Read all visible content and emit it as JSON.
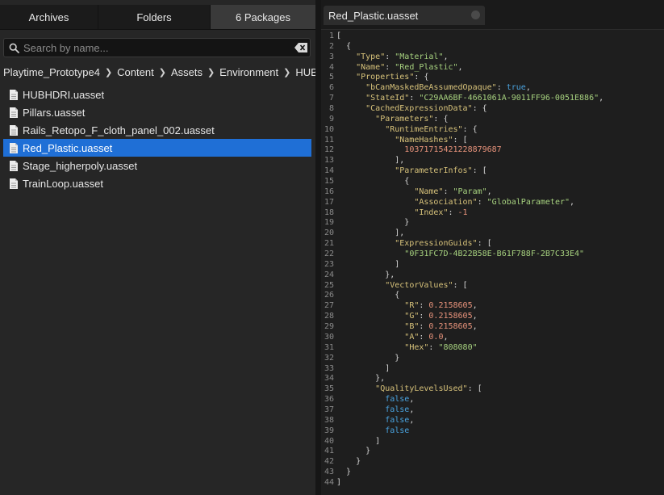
{
  "left_panel": {
    "tabs": [
      "Archives",
      "Folders",
      "6 Packages"
    ],
    "active_tab": "6 Packages",
    "search": {
      "placeholder": "Search by name..."
    },
    "breadcrumb": [
      "Playtime_Prototype4",
      "Content",
      "Assets",
      "Environment",
      "HUB"
    ],
    "files": [
      "HUBHDRI.uasset",
      "Pillars.uasset",
      "Rails_Retopo_F_cloth_panel_002.uasset",
      "Red_Plastic.uasset",
      "Stage_higherpoly.uasset",
      "TrainLoop.uasset"
    ],
    "selected_file": "Red_Plastic.uasset"
  },
  "editor": {
    "tab_title": "Red_Plastic.uasset",
    "lines": [
      [
        [
          "p",
          "["
        ]
      ],
      [
        [
          "p",
          "  {"
        ]
      ],
      [
        [
          "p",
          "    "
        ],
        [
          "k",
          "\"Type\""
        ],
        [
          "p",
          ": "
        ],
        [
          "s",
          "\"Material\""
        ],
        [
          "p",
          ","
        ]
      ],
      [
        [
          "p",
          "    "
        ],
        [
          "k",
          "\"Name\""
        ],
        [
          "p",
          ": "
        ],
        [
          "s",
          "\"Red_Plastic\""
        ],
        [
          "p",
          ","
        ]
      ],
      [
        [
          "p",
          "    "
        ],
        [
          "k",
          "\"Properties\""
        ],
        [
          "p",
          ": {"
        ]
      ],
      [
        [
          "p",
          "      "
        ],
        [
          "k",
          "\"bCanMaskedBeAssumedOpaque\""
        ],
        [
          "p",
          ": "
        ],
        [
          "b",
          "true"
        ],
        [
          "p",
          ","
        ]
      ],
      [
        [
          "p",
          "      "
        ],
        [
          "k",
          "\"StateId\""
        ],
        [
          "p",
          ": "
        ],
        [
          "s",
          "\"C29AA6BF-4661061A-9011FF96-0051E886\""
        ],
        [
          "p",
          ","
        ]
      ],
      [
        [
          "p",
          "      "
        ],
        [
          "k",
          "\"CachedExpressionData\""
        ],
        [
          "p",
          ": {"
        ]
      ],
      [
        [
          "p",
          "        "
        ],
        [
          "k",
          "\"Parameters\""
        ],
        [
          "p",
          ": {"
        ]
      ],
      [
        [
          "p",
          "          "
        ],
        [
          "k",
          "\"RuntimeEntries\""
        ],
        [
          "p",
          ": {"
        ]
      ],
      [
        [
          "p",
          "            "
        ],
        [
          "k",
          "\"NameHashes\""
        ],
        [
          "p",
          ": ["
        ]
      ],
      [
        [
          "p",
          "              "
        ],
        [
          "n",
          "10371715421228879687"
        ]
      ],
      [
        [
          "p",
          "            ],"
        ]
      ],
      [
        [
          "p",
          "            "
        ],
        [
          "k",
          "\"ParameterInfos\""
        ],
        [
          "p",
          ": ["
        ]
      ],
      [
        [
          "p",
          "              {"
        ]
      ],
      [
        [
          "p",
          "                "
        ],
        [
          "k",
          "\"Name\""
        ],
        [
          "p",
          ": "
        ],
        [
          "s",
          "\"Param\""
        ],
        [
          "p",
          ","
        ]
      ],
      [
        [
          "p",
          "                "
        ],
        [
          "k",
          "\"Association\""
        ],
        [
          "p",
          ": "
        ],
        [
          "s",
          "\"GlobalParameter\""
        ],
        [
          "p",
          ","
        ]
      ],
      [
        [
          "p",
          "                "
        ],
        [
          "k",
          "\"Index\""
        ],
        [
          "p",
          ": "
        ],
        [
          "n",
          "-1"
        ]
      ],
      [
        [
          "p",
          "              }"
        ]
      ],
      [
        [
          "p",
          "            ],"
        ]
      ],
      [
        [
          "p",
          "            "
        ],
        [
          "k",
          "\"ExpressionGuids\""
        ],
        [
          "p",
          ": ["
        ]
      ],
      [
        [
          "p",
          "              "
        ],
        [
          "s",
          "\"0F31FC7D-4B22B58E-B61F788F-2B7C33E4\""
        ]
      ],
      [
        [
          "p",
          "            ]"
        ]
      ],
      [
        [
          "p",
          "          },"
        ]
      ],
      [
        [
          "p",
          "          "
        ],
        [
          "k",
          "\"VectorValues\""
        ],
        [
          "p",
          ": ["
        ]
      ],
      [
        [
          "p",
          "            {"
        ]
      ],
      [
        [
          "p",
          "              "
        ],
        [
          "k",
          "\"R\""
        ],
        [
          "p",
          ": "
        ],
        [
          "n",
          "0.2158605"
        ],
        [
          "p",
          ","
        ]
      ],
      [
        [
          "p",
          "              "
        ],
        [
          "k",
          "\"G\""
        ],
        [
          "p",
          ": "
        ],
        [
          "n",
          "0.2158605"
        ],
        [
          "p",
          ","
        ]
      ],
      [
        [
          "p",
          "              "
        ],
        [
          "k",
          "\"B\""
        ],
        [
          "p",
          ": "
        ],
        [
          "n",
          "0.2158605"
        ],
        [
          "p",
          ","
        ]
      ],
      [
        [
          "p",
          "              "
        ],
        [
          "k",
          "\"A\""
        ],
        [
          "p",
          ": "
        ],
        [
          "n",
          "0.0"
        ],
        [
          "p",
          ","
        ]
      ],
      [
        [
          "p",
          "              "
        ],
        [
          "k",
          "\"Hex\""
        ],
        [
          "p",
          ": "
        ],
        [
          "s",
          "\"808080\""
        ]
      ],
      [
        [
          "p",
          "            }"
        ]
      ],
      [
        [
          "p",
          "          ]"
        ]
      ],
      [
        [
          "p",
          "        },"
        ]
      ],
      [
        [
          "p",
          "        "
        ],
        [
          "k",
          "\"QualityLevelsUsed\""
        ],
        [
          "p",
          ": ["
        ]
      ],
      [
        [
          "p",
          "          "
        ],
        [
          "b",
          "false"
        ],
        [
          "p",
          ","
        ]
      ],
      [
        [
          "p",
          "          "
        ],
        [
          "b",
          "false"
        ],
        [
          "p",
          ","
        ]
      ],
      [
        [
          "p",
          "          "
        ],
        [
          "b",
          "false"
        ],
        [
          "p",
          ","
        ]
      ],
      [
        [
          "p",
          "          "
        ],
        [
          "b",
          "false"
        ]
      ],
      [
        [
          "p",
          "        ]"
        ]
      ],
      [
        [
          "p",
          "      }"
        ]
      ],
      [
        [
          "p",
          "    }"
        ]
      ],
      [
        [
          "p",
          "  }"
        ]
      ],
      [
        [
          "p",
          "]"
        ]
      ]
    ]
  },
  "icons": {
    "search": "search-icon",
    "clear": "clear-search-icon",
    "breadcrumb_separator": "chevron-right-icon",
    "file": "file-icon",
    "tab_close": "close-tab-icon"
  },
  "colors": {
    "selection": "#1f6fd6",
    "json_key": "#d7c27a",
    "json_string": "#a7d27f",
    "json_number": "#e8937b",
    "json_boolean": "#4aa3df"
  }
}
